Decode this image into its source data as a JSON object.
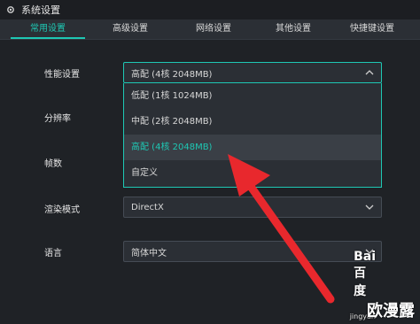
{
  "window": {
    "title": "系统设置",
    "icon": "gear-icon"
  },
  "tabs": [
    {
      "label": "常用设置",
      "active": true
    },
    {
      "label": "高级设置",
      "active": false
    },
    {
      "label": "网络设置",
      "active": false
    },
    {
      "label": "其他设置",
      "active": false
    },
    {
      "label": "快捷键设置",
      "active": false
    }
  ],
  "settings": {
    "performance": {
      "label": "性能设置",
      "value": "高配 (4核 2048MB)"
    },
    "resolution": {
      "label": "分辨率"
    },
    "framerate": {
      "label": "帧数"
    },
    "render_mode": {
      "label": "渲染模式",
      "value": "DirectX"
    },
    "language": {
      "label": "语言",
      "value": "简体中文"
    }
  },
  "dropdown": {
    "options": [
      {
        "label": "低配 (1核 1024MB)",
        "selected": false
      },
      {
        "label": "中配 (2核 2048MB)",
        "selected": false
      },
      {
        "label": "高配 (4核 2048MB)",
        "selected": true
      },
      {
        "label": "自定义",
        "selected": false
      }
    ]
  },
  "watermark": {
    "brand": "Bai 百度",
    "sub": "jingyan",
    "text": "欧漫露"
  },
  "colors": {
    "accent": "#1ec8b4",
    "arrow": "#e8282d",
    "background": "#1f2226"
  }
}
